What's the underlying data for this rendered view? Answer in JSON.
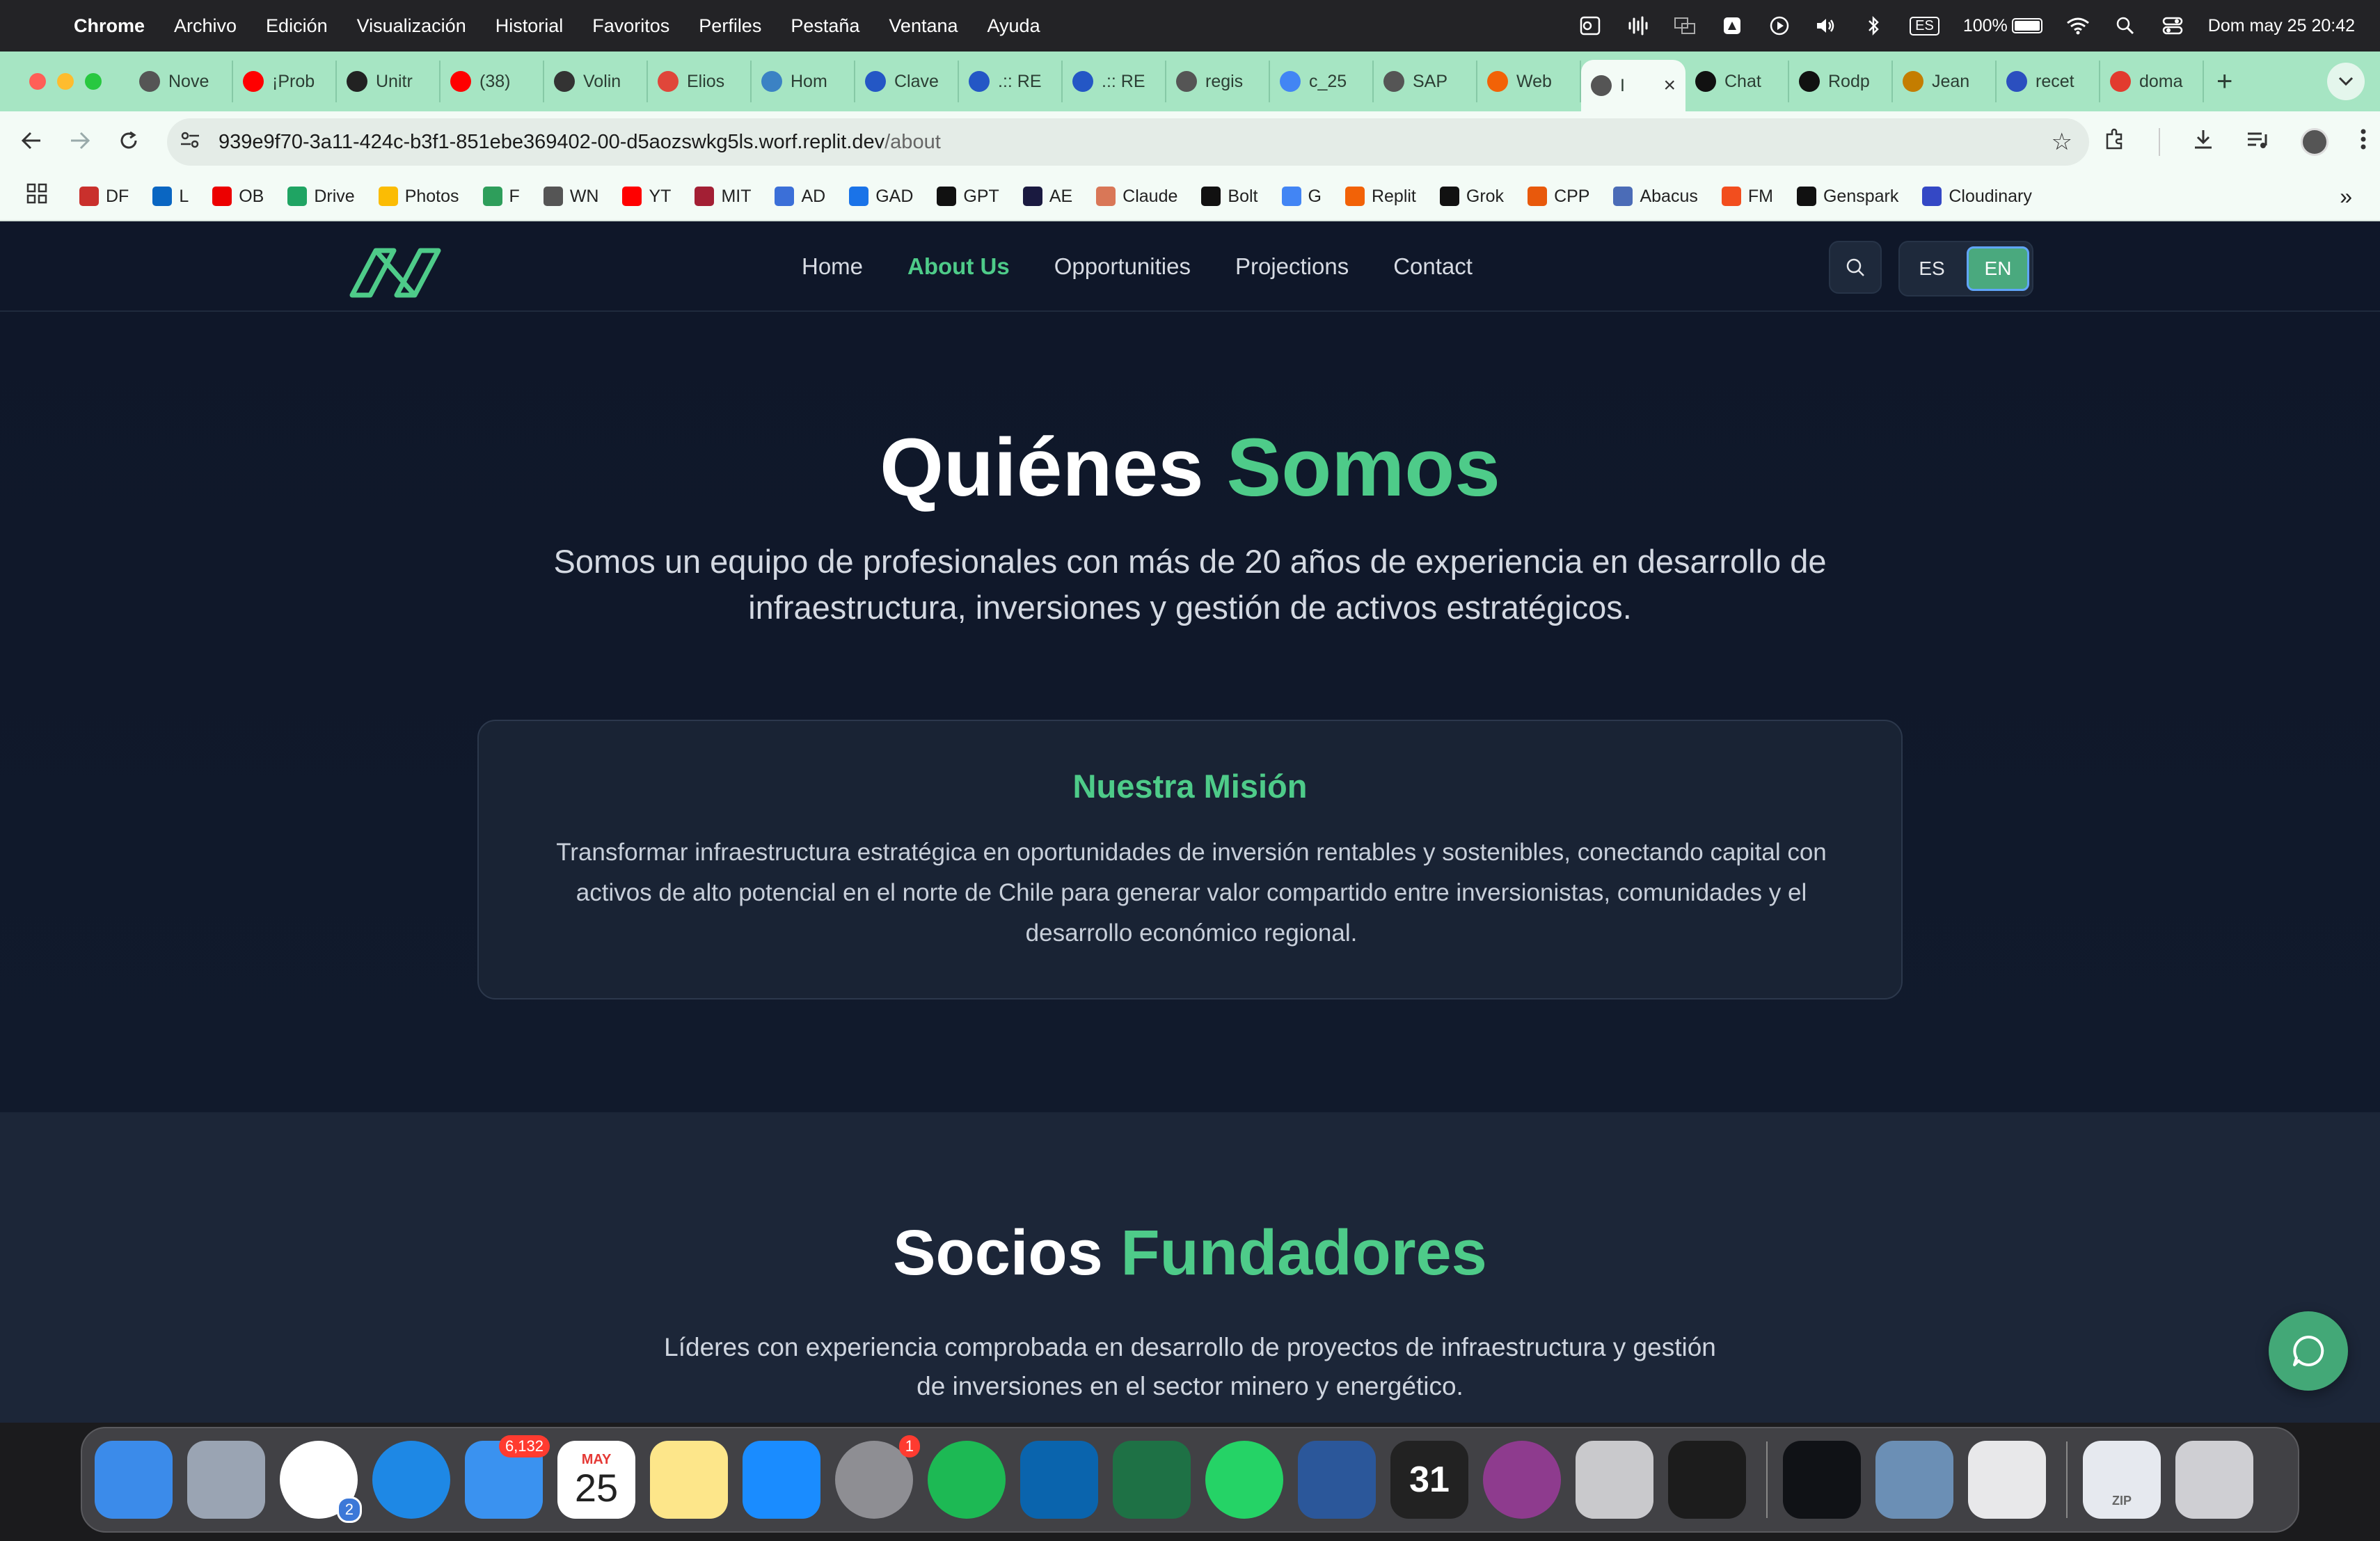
{
  "menubar": {
    "app_name": "Chrome",
    "items": [
      "Archivo",
      "Edición",
      "Visualización",
      "Historial",
      "Favoritos",
      "Perfiles",
      "Pestaña",
      "Ventana",
      "Ayuda"
    ],
    "input_source": "ES",
    "battery": "100%",
    "battery_level": 1.0,
    "clock": "Dom may 25  20:42"
  },
  "tabs": [
    {
      "title": "Nove",
      "icon": "chrome-icon",
      "color": "#555555"
    },
    {
      "title": "¡Prob",
      "icon": "youtube-icon",
      "color": "#ff0000"
    },
    {
      "title": "Unitr",
      "icon": "unitr-icon",
      "color": "#222222"
    },
    {
      "title": "(38)",
      "icon": "youtube-icon",
      "color": "#ff0000"
    },
    {
      "title": "Volin",
      "icon": "v-icon",
      "color": "#333333"
    },
    {
      "title": "Elios",
      "icon": "elios-icon",
      "color": "#e0463a"
    },
    {
      "title": "Hom",
      "icon": "home-icon",
      "color": "#3b82c4"
    },
    {
      "title": "Clave",
      "icon": "clave-icon",
      "color": "#2457c5"
    },
    {
      "title": ".:: RE",
      "icon": "clave-icon",
      "color": "#2457c5"
    },
    {
      "title": ".:: RE",
      "icon": "clave-icon",
      "color": "#2457c5"
    },
    {
      "title": "regis",
      "icon": "globe-icon",
      "color": "#555555"
    },
    {
      "title": "c_25",
      "icon": "docs-icon",
      "color": "#4285f4"
    },
    {
      "title": "SAP",
      "icon": "globe-icon",
      "color": "#555555"
    },
    {
      "title": "Web",
      "icon": "replit-icon",
      "color": "#f26207"
    },
    {
      "title": "I",
      "icon": "globe-icon",
      "color": "#555555",
      "active": true
    },
    {
      "title": "Chat",
      "icon": "openai-icon",
      "color": "#111111"
    },
    {
      "title": "Rodp",
      "icon": "github-icon",
      "color": "#111111"
    },
    {
      "title": "Jean",
      "icon": "df-icon",
      "color": "#c47d00"
    },
    {
      "title": "recet",
      "icon": "bank-icon",
      "color": "#2b4fbf"
    },
    {
      "title": "doma",
      "icon": "d-icon",
      "color": "#e23b2e"
    }
  ],
  "address_bar": {
    "host": "939e9f70-3a11-424c-b3f1-851ebe369402-00-d5aozswkg5ls.worf.replit.dev",
    "path": "/about"
  },
  "bookmarks": [
    {
      "label": "DF",
      "color": "#c9302c"
    },
    {
      "label": "L",
      "color": "#0a66c2"
    },
    {
      "label": "OB",
      "color": "#ec0000"
    },
    {
      "label": "Drive",
      "color": "#1fa463"
    },
    {
      "label": "Photos",
      "color": "#fbbc04"
    },
    {
      "label": "F",
      "color": "#2e9e5b"
    },
    {
      "label": "WN",
      "color": "#555555"
    },
    {
      "label": "YT",
      "color": "#ff0000"
    },
    {
      "label": "MIT",
      "color": "#a31f34"
    },
    {
      "label": "AD",
      "color": "#3b6fd8"
    },
    {
      "label": "GAD",
      "color": "#1a73e8"
    },
    {
      "label": "GPT",
      "color": "#111111"
    },
    {
      "label": "AE",
      "color": "#1a1a40"
    },
    {
      "label": "Claude",
      "color": "#d97757"
    },
    {
      "label": "Bolt",
      "color": "#111111"
    },
    {
      "label": "G",
      "color": "#4285f4"
    },
    {
      "label": "Replit",
      "color": "#f26207"
    },
    {
      "label": "Grok",
      "color": "#111111"
    },
    {
      "label": "CPP",
      "color": "#e8590c"
    },
    {
      "label": "Abacus",
      "color": "#4b6cb7"
    },
    {
      "label": "FM",
      "color": "#f24e1e"
    },
    {
      "label": "Genspark",
      "color": "#111111"
    },
    {
      "label": "Cloudinary",
      "color": "#3448c5"
    }
  ],
  "site": {
    "nav": [
      "Home",
      "About Us",
      "Opportunities",
      "Projections",
      "Contact"
    ],
    "active_nav": "About Us",
    "lang": {
      "es": "ES",
      "en": "EN",
      "active": "EN"
    },
    "accent_color": "#4ecb89",
    "about": {
      "title_main": "Quiénes",
      "title_accent": "Somos",
      "intro": "Somos un equipo de profesionales con más de 20 años de experiencia en desarrollo de infraestructura, inversiones y gestión de activos estratégicos."
    },
    "mission": {
      "title": "Nuestra Misión",
      "text": "Transformar infraestructura estratégica en oportunidades de inversión rentables y sostenibles, conectando capital con activos de alto potencial en el norte de Chile para generar valor compartido entre inversionistas, comunidades y el desarrollo económico regional."
    },
    "founders": {
      "title_main": "Socios",
      "title_accent": "Fundadores",
      "intro": "Líderes con experiencia comprobada en desarrollo de proyectos de infraestructura y gestión de inversiones en el sector minero y energético."
    }
  },
  "dock": {
    "apps": [
      {
        "name": "finder",
        "color": "#3b8bea"
      },
      {
        "name": "launchpad",
        "color": "#9aa4b3"
      },
      {
        "name": "chrome",
        "color": "#ffffff",
        "badge": "2"
      },
      {
        "name": "safari",
        "color": "#1e88e5"
      },
      {
        "name": "mail",
        "color": "#3a92f0",
        "badge": "6,132"
      },
      {
        "name": "calendar",
        "color": "#ffffff",
        "month": "MAY",
        "day": "25"
      },
      {
        "name": "notes",
        "color": "#fde68a"
      },
      {
        "name": "keynote",
        "color": "#1a8cff"
      },
      {
        "name": "system-settings",
        "color": "#8e8e93",
        "badge": "1"
      },
      {
        "name": "spotify",
        "color": "#1db954"
      },
      {
        "name": "outlook",
        "color": "#0a64ad"
      },
      {
        "name": "excel",
        "color": "#1e7145"
      },
      {
        "name": "whatsapp",
        "color": "#25d366"
      },
      {
        "name": "word",
        "color": "#2b579a"
      },
      {
        "name": "fantastical",
        "color": "#222222",
        "day": "31"
      },
      {
        "name": "screen-recorder",
        "color": "#8e3b8e"
      },
      {
        "name": "iphone-mirroring",
        "color": "#c9c9cc"
      },
      {
        "name": "replit",
        "color": "#1c1c1c"
      },
      {
        "name": "webex",
        "color": "#101216"
      },
      {
        "name": "preview",
        "color": "#6b8fb5"
      },
      {
        "name": "utility",
        "color": "#e8e8ea"
      },
      {
        "name": "archive",
        "color": "#e6e9ef",
        "label": "ZIP"
      },
      {
        "name": "trash",
        "color": "#cfcfd3"
      }
    ]
  }
}
